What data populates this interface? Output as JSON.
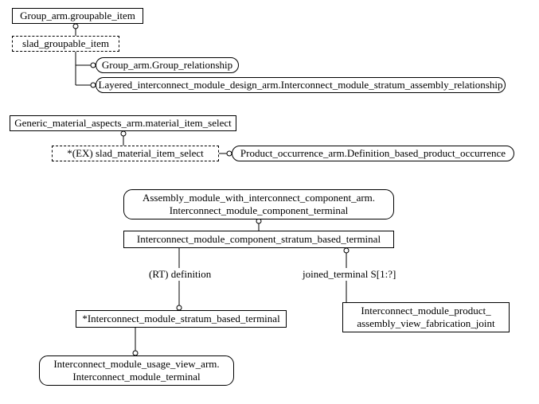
{
  "nodes": {
    "group_arm_groupable_item": "Group_arm.groupable_item",
    "slad_groupable_item": "slad_groupable_item",
    "group_arm_group_relationship": "Group_arm.Group_relationship",
    "layered_interconnect": "Layered_interconnect_module_design_arm.Interconnect_module_stratum_assembly_relationship",
    "generic_material_aspects": "Generic_material_aspects_arm.material_item_select",
    "slad_material_item_select": "*(EX) slad_material_item_select",
    "product_occurrence": "Product_occurrence_arm.Definition_based_product_occurrence",
    "assembly_module_terminal_line1": "Assembly_module_with_interconnect_component_arm.",
    "assembly_module_terminal_line2": "Interconnect_module_component_terminal",
    "icm_component_stratum_terminal": "Interconnect_module_component_stratum_based_terminal",
    "rt_definition": "(RT) definition",
    "joined_terminal": "joined_terminal S[1:?]",
    "icm_stratum_based_terminal": "*Interconnect_module_stratum_based_terminal",
    "icm_product_joint_line1": "Interconnect_module_product_",
    "icm_product_joint_line2": "assembly_view_fabrication_joint",
    "icm_usage_view_line1": "Interconnect_module_usage_view_arm.",
    "icm_usage_view_line2": "Interconnect_module_terminal"
  }
}
